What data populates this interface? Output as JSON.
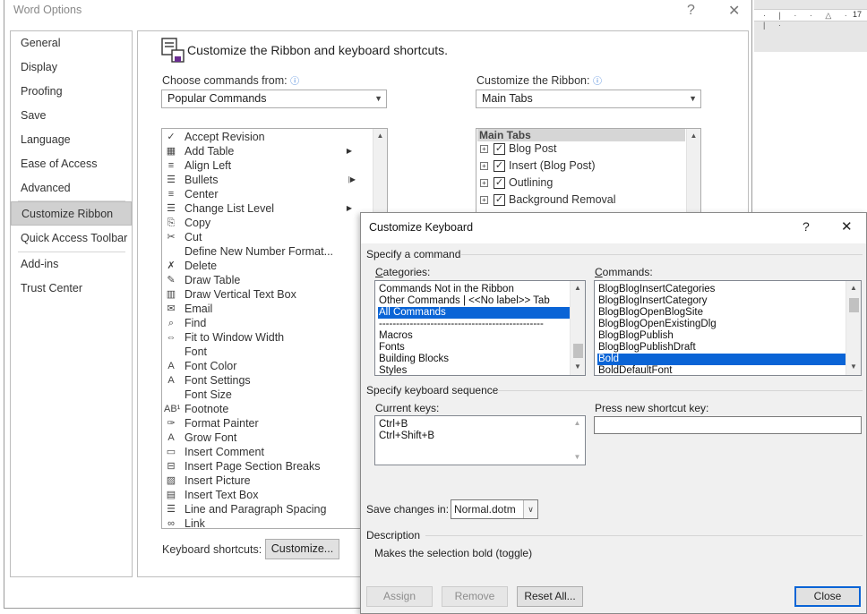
{
  "word_options": {
    "title": "Word Options",
    "help_btn": "?",
    "close_btn": "✕",
    "nav": [
      {
        "label": "General"
      },
      {
        "label": "Display"
      },
      {
        "label": "Proofing"
      },
      {
        "label": "Save"
      },
      {
        "label": "Language"
      },
      {
        "label": "Ease of Access"
      },
      {
        "label": "Advanced"
      },
      {
        "label": "Customize Ribbon"
      },
      {
        "label": "Quick Access Toolbar"
      },
      {
        "label": "Add-ins"
      },
      {
        "label": "Trust Center"
      }
    ],
    "header": "Customize the Ribbon and keyboard shortcuts.",
    "choose_label": "Choose commands from:",
    "choose_value": "Popular Commands",
    "ribbon_label": "Customize the Ribbon:",
    "ribbon_value": "Main Tabs",
    "commands": [
      {
        "label": "Accept Revision",
        "icon": "✓"
      },
      {
        "label": "Add Table",
        "icon": "▦",
        "submenu": true
      },
      {
        "label": "Align Left",
        "icon": "≡"
      },
      {
        "label": "Bullets",
        "icon": "☰",
        "split": true
      },
      {
        "label": "Center",
        "icon": "≡"
      },
      {
        "label": "Change List Level",
        "icon": "☰",
        "submenu": true
      },
      {
        "label": "Copy",
        "icon": "⎘"
      },
      {
        "label": "Cut",
        "icon": "✂"
      },
      {
        "label": "Define New Number Format...",
        "icon": ""
      },
      {
        "label": "Delete",
        "icon": "✗"
      },
      {
        "label": "Draw Table",
        "icon": "✎"
      },
      {
        "label": "Draw Vertical Text Box",
        "icon": "▥"
      },
      {
        "label": "Email",
        "icon": "✉"
      },
      {
        "label": "Find",
        "icon": "⌕"
      },
      {
        "label": "Fit to Window Width",
        "icon": "⇔"
      },
      {
        "label": "Font",
        "icon": ""
      },
      {
        "label": "Font Color",
        "icon": "A"
      },
      {
        "label": "Font Settings",
        "icon": "A"
      },
      {
        "label": "Font Size",
        "icon": ""
      },
      {
        "label": "Footnote",
        "icon": "AB¹"
      },
      {
        "label": "Format Painter",
        "icon": "✑"
      },
      {
        "label": "Grow Font",
        "icon": "A"
      },
      {
        "label": "Insert Comment",
        "icon": "▭"
      },
      {
        "label": "Insert Page  Section Breaks",
        "icon": "⊟"
      },
      {
        "label": "Insert Picture",
        "icon": "▨"
      },
      {
        "label": "Insert Text Box",
        "icon": "▤"
      },
      {
        "label": "Line and Paragraph Spacing",
        "icon": "☰"
      },
      {
        "label": "Link",
        "icon": "∞"
      }
    ],
    "ribbon_tree_header": "Main Tabs",
    "ribbon_tree": [
      {
        "label": "Blog Post",
        "checked": true
      },
      {
        "label": "Insert (Blog Post)",
        "checked": true
      },
      {
        "label": "Outlining",
        "checked": true
      },
      {
        "label": "Background Removal",
        "checked": true
      }
    ],
    "keyboard_shortcuts_label": "Keyboard shortcuts:",
    "customize_btn": "Customize..."
  },
  "ruler": {
    "number": "17"
  },
  "keyboard": {
    "title": "Customize Keyboard",
    "help_btn": "?",
    "close_btn": "✕",
    "specify_command": "Specify a command",
    "categories_label": "Categories:",
    "categories": [
      {
        "label": "Commands Not in the Ribbon"
      },
      {
        "label": "Other Commands | <<No label>> Tab"
      },
      {
        "label": "All Commands",
        "selected": true
      },
      {
        "label": "------------------------------------------------"
      },
      {
        "label": "Macros"
      },
      {
        "label": "Fonts"
      },
      {
        "label": "Building Blocks"
      },
      {
        "label": "Styles"
      }
    ],
    "commands_label": "Commands:",
    "commands": [
      {
        "label": "BlogBlogInsertCategories"
      },
      {
        "label": "BlogBlogInsertCategory"
      },
      {
        "label": "BlogBlogOpenBlogSite"
      },
      {
        "label": "BlogBlogOpenExistingDlg"
      },
      {
        "label": "BlogBlogPublish"
      },
      {
        "label": "BlogBlogPublishDraft"
      },
      {
        "label": "Bold",
        "selected": true
      },
      {
        "label": "BoldDefaultFont"
      }
    ],
    "specify_sequence": "Specify keyboard sequence",
    "current_keys_label": "Current keys:",
    "current_keys": [
      "Ctrl+B",
      "Ctrl+Shift+B"
    ],
    "new_shortcut_label": "Press new shortcut key:",
    "new_shortcut_value": "",
    "save_changes_label": "Save changes in:",
    "save_changes_value": "Normal.dotm",
    "description_label": "Description",
    "description_text": "Makes the selection bold (toggle)",
    "assign_btn": "Assign",
    "remove_btn": "Remove",
    "reset_btn": "Reset All...",
    "close_btn_label": "Close"
  }
}
